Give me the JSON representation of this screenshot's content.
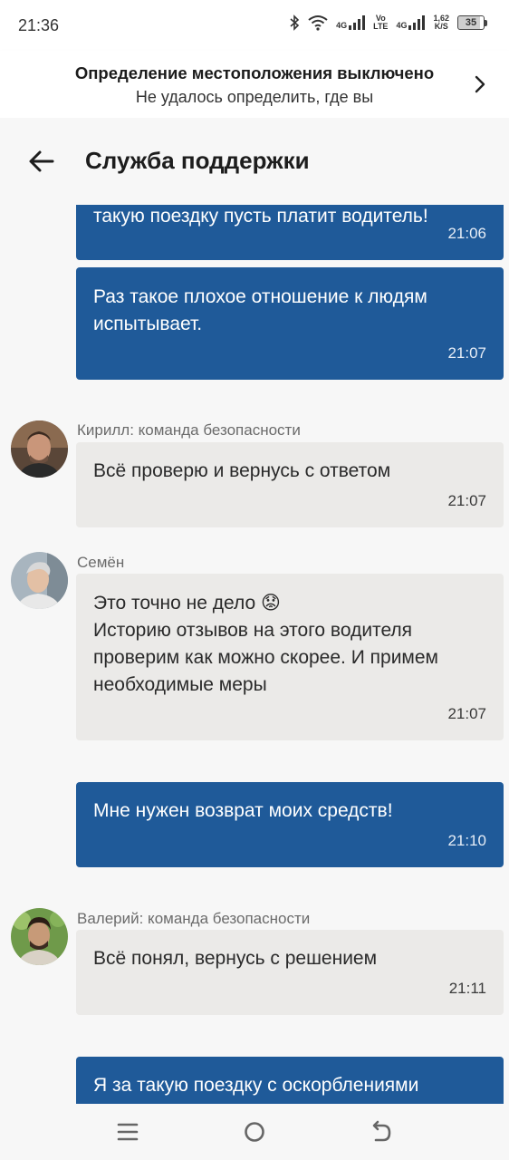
{
  "status_bar": {
    "time": "21:36",
    "net_4g_1": "4G",
    "volte_top": "Vo",
    "volte_bottom": "LTE",
    "net_4g_2": "4G",
    "speed_value": "1,62",
    "speed_unit": "K/S",
    "battery": "35",
    "icons": [
      "bluetooth-icon",
      "wifi-icon",
      "signal-icon",
      "battery-icon"
    ]
  },
  "location_banner": {
    "title": "Определение местоположения выключено",
    "subtitle": "Не удалось определить, где вы"
  },
  "header": {
    "title": "Служба поддержки"
  },
  "messages": [
    {
      "direction": "out",
      "text": "такую поездку пусть платит водитель!",
      "time": "21:06"
    },
    {
      "direction": "out",
      "text": "Раз такое плохое отношение к людям испытывает.",
      "time": "21:07"
    },
    {
      "direction": "in",
      "sender": "Кирилл: команда безопасности",
      "text": "Всё проверю и вернусь с ответом",
      "time": "21:07"
    },
    {
      "direction": "in",
      "sender": "Семён",
      "text": "Это точно не дело 😟\nИсторию отзывов на этого водителя проверим как можно скорее. И примем необходимые меры",
      "time": "21:07"
    },
    {
      "direction": "out",
      "text": "Мне нужен возврат моих средств!",
      "time": "21:10"
    },
    {
      "direction": "in",
      "sender": "Валерий: команда безопасности",
      "text": "Всё понял, вернусь с решением",
      "time": "21:11"
    },
    {
      "direction": "out",
      "text": "Я за такую поездку с оскорблениями",
      "time": ""
    }
  ],
  "colors": {
    "outgoing_bubble": "#1f5a99",
    "incoming_bubble": "#ebeae8",
    "background": "#f7f7f7"
  }
}
